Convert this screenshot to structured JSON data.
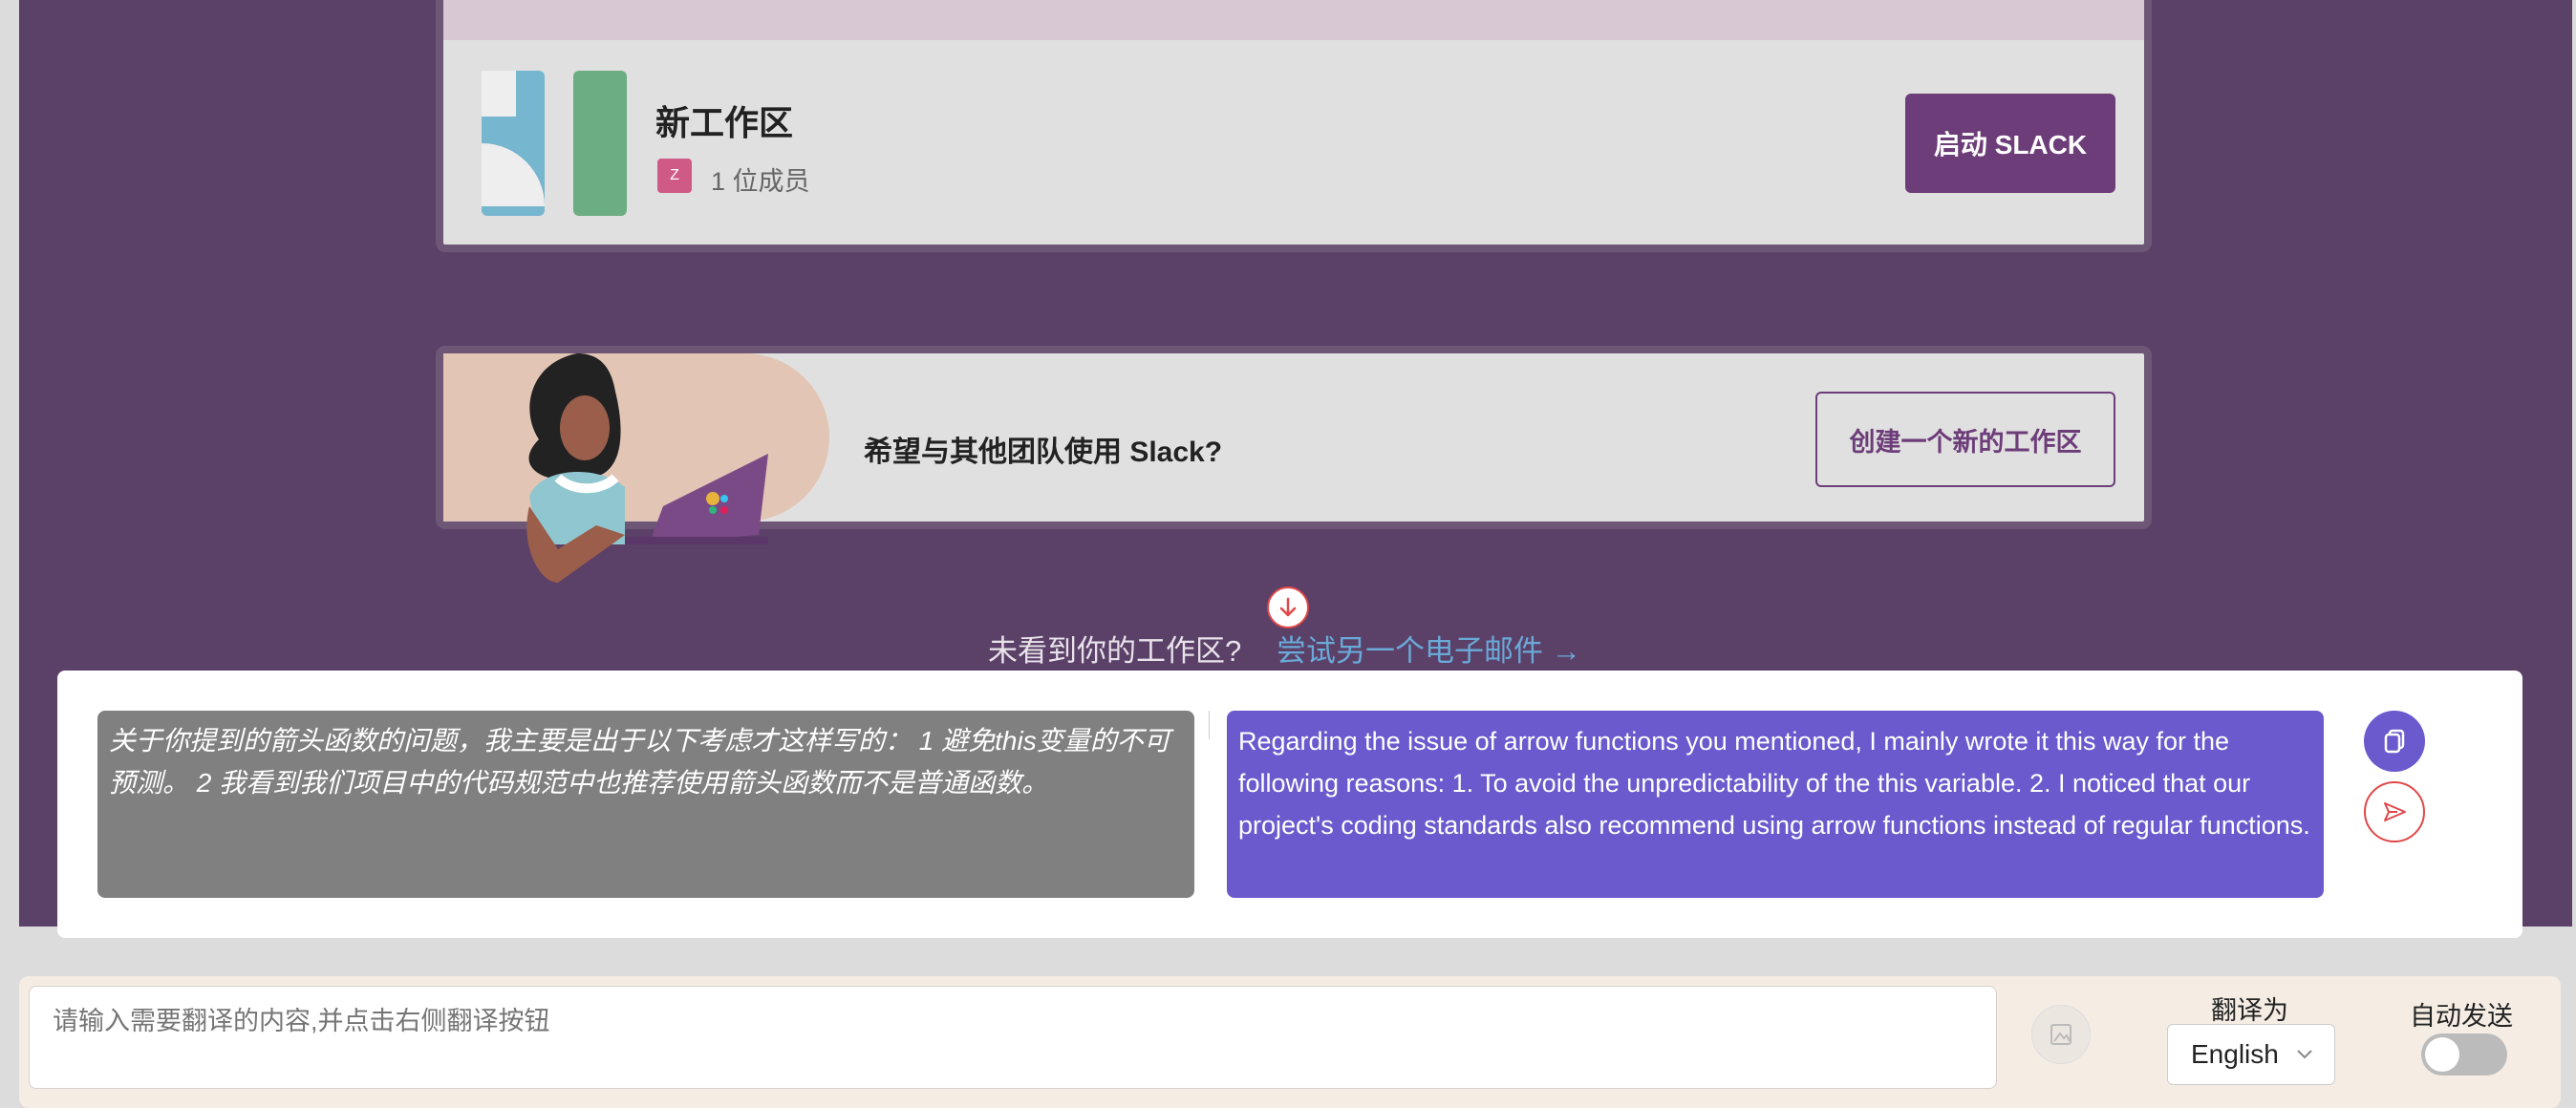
{
  "workspace": {
    "name": "新工作区",
    "member_avatar": "Z",
    "member_count": "1 位成员",
    "launch_button": "启动 SLACK"
  },
  "promo": {
    "text": "希望与其他团队使用 Slack?",
    "create_button": "创建一个新的工作区"
  },
  "footer_links": {
    "not_found": "未看到你的工作区?",
    "try_other": "尝试另一个电子邮件 →"
  },
  "translation": {
    "source_text": "关于你提到的箭头函数的问题，我主要是出于以下考虑才这样写的： 1 避免this变量的不可预测。 2 我看到我们项目中的代码规范中也推荐使用箭头函数而不是普通函数。",
    "translated_text": "Regarding the issue of arrow functions you mentioned, I mainly wrote it this way for the following reasons: 1. To avoid the unpredictability of the this variable. 2. I noticed that our project's coding standards also recommend using arrow functions instead of regular functions."
  },
  "input_bar": {
    "placeholder": "请输入需要翻译的内容,并点击右侧翻译按钮",
    "translate_to_label": "翻译为",
    "language": "English",
    "auto_send_label": "自动发送",
    "auto_send_enabled": false
  },
  "colors": {
    "page_purple": "#5b4168",
    "brand_purple": "#6d3d79",
    "translation_purple": "#6a5acd",
    "link_blue": "#6aa9d8"
  }
}
